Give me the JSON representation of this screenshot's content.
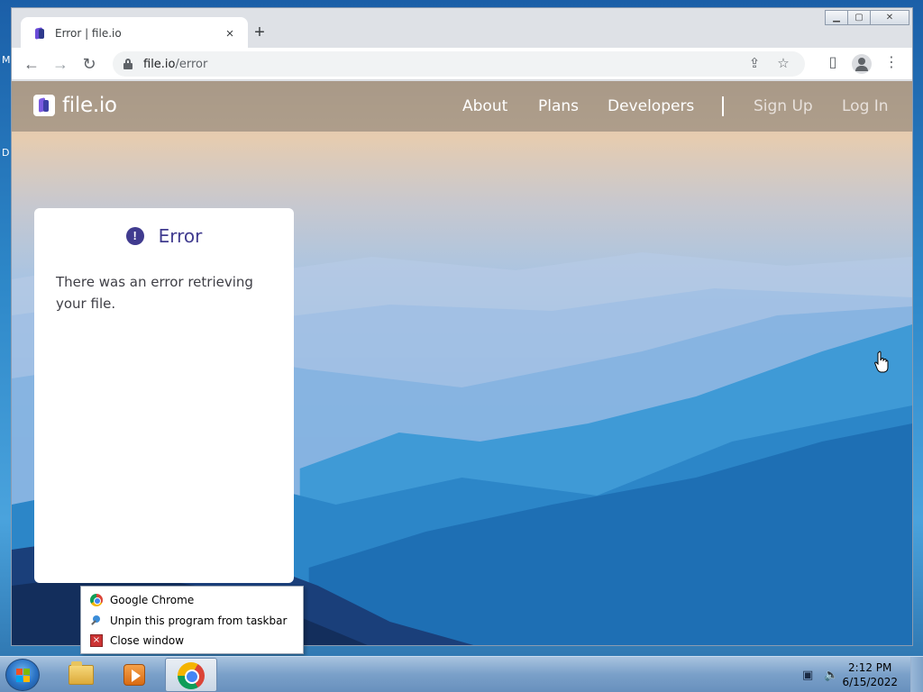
{
  "desktop": {
    "edge_letters": [
      "M",
      "D"
    ]
  },
  "browser": {
    "tab": {
      "title": "Error | file.io",
      "favicon": "file-io-icon",
      "close": "×"
    },
    "new_tab": "+",
    "window_controls": {
      "minimize": "▁",
      "maximize": "▢",
      "close": "✕"
    },
    "toolbar": {
      "back": "←",
      "forward": "→",
      "reload": "↻",
      "url_host": "file.io",
      "url_path": "/error",
      "share": "⇪",
      "bookmark": "☆",
      "side_panel": "▯",
      "menu": "⋮"
    }
  },
  "site": {
    "logo_text": "file.io",
    "nav": {
      "about": "About",
      "plans": "Plans",
      "developers": "Developers",
      "sign_up": "Sign Up",
      "log_in": "Log In"
    },
    "error_card": {
      "icon": "!",
      "title": "Error",
      "message": "There was an error retrieving your file."
    }
  },
  "jump_list": {
    "items": [
      {
        "label": "Google Chrome",
        "icon": "chrome-icon"
      },
      {
        "label": "Unpin this program from taskbar",
        "icon": "unpin-icon"
      },
      {
        "label": "Close window",
        "icon": "close-window-icon"
      }
    ]
  },
  "taskbar": {
    "apps": [
      "file-explorer",
      "windows-media-player",
      "google-chrome"
    ],
    "clock": {
      "time": "2:12 PM",
      "date": "6/15/2022"
    }
  },
  "colors": {
    "accent": "#403b8f",
    "logo_purple": "#7a5ae0"
  }
}
